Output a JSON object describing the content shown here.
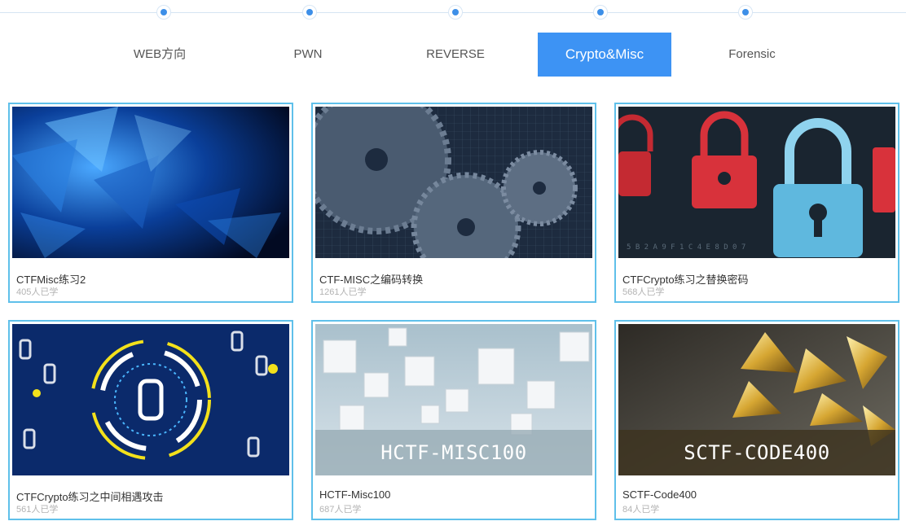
{
  "tabs": [
    {
      "label": "WEB方向",
      "active": false
    },
    {
      "label": "PWN",
      "active": false
    },
    {
      "label": "REVERSE",
      "active": false
    },
    {
      "label": "Crypto&Misc",
      "active": true
    },
    {
      "label": "Forensic",
      "active": false
    }
  ],
  "accent_color": "#3d93f4",
  "card_border_color": "#5fc0ea",
  "courses": [
    {
      "title": "CTFMisc练习2",
      "learners": "405人已学",
      "image": "blue-crystal-shards"
    },
    {
      "title": "CTF-MISC之编码转换",
      "learners": "1261人已学",
      "image": "gears"
    },
    {
      "title": "CTFCrypto练习之替换密码",
      "learners": "568人已学",
      "image": "padlocks"
    },
    {
      "title": "CTFCrypto练习之中间相遇攻击",
      "learners": "561人已学",
      "image": "binary-circle"
    },
    {
      "title": "HCTF-Misc100",
      "learners": "687人已学",
      "image": "white-cubes",
      "banner": "HCTF-MISC100"
    },
    {
      "title": "SCTF-Code400",
      "learners": "84人已学",
      "image": "gold-pyramids",
      "banner": "SCTF-CODE400"
    }
  ]
}
